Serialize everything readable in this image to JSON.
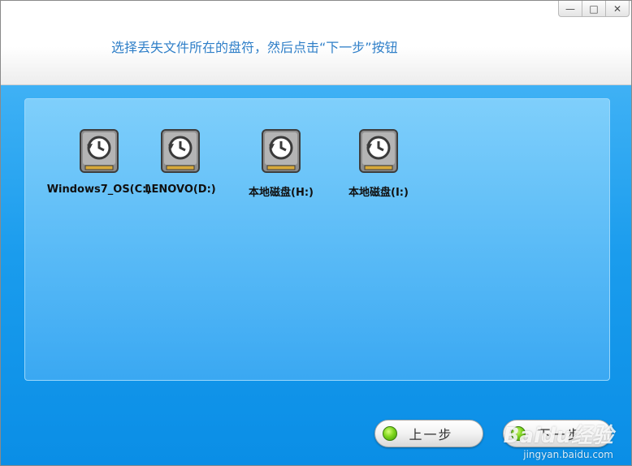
{
  "window_controls": {
    "minimize_icon": "minimize-icon",
    "maximize_icon": "maximize-icon",
    "close_icon": "close-icon",
    "minimize": "—",
    "maximize": "□",
    "close": "✕"
  },
  "header": {
    "instruction": "选择丢失文件所在的盘符，然后点击“下一步”按钮"
  },
  "drives": [
    {
      "label": "Windows7_OS(C:)",
      "icon": "hard-drive-restore-icon"
    },
    {
      "label": "LENOVO(D:)",
      "icon": "hard-drive-restore-icon"
    },
    {
      "label": "本地磁盘(H:)",
      "icon": "hard-drive-restore-icon"
    },
    {
      "label": "本地磁盘(I:)",
      "icon": "hard-drive-restore-icon"
    }
  ],
  "nav": {
    "prev_label": "上一步",
    "next_label": "下一步"
  },
  "colors": {
    "accent_text": "#2f7fc8",
    "content_bg": "#1a9ced",
    "button_dot": "#7fd61d"
  },
  "watermark": {
    "main": "Baidu经验",
    "sub": "jingyan.baidu.com"
  }
}
